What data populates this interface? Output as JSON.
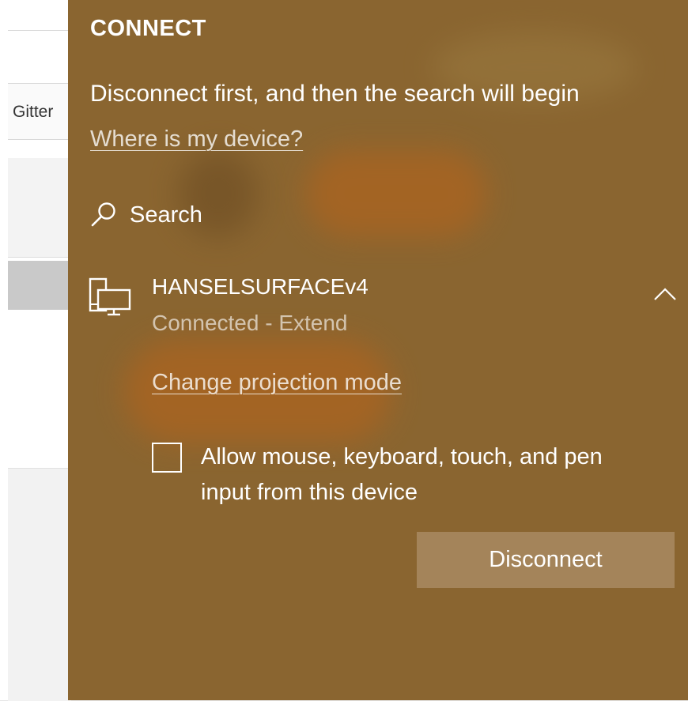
{
  "background_app": {
    "visible_tab_label": "Gitter"
  },
  "flyout": {
    "title": "CONNECT",
    "message": "Disconnect first, and then the search will begin",
    "where_link": "Where is my device?",
    "search": {
      "icon": "search-icon",
      "label": "Search"
    },
    "device": {
      "icon": "display-device-icon",
      "name": "HANSELSURFACEv4",
      "status": "Connected - Extend",
      "expand_icon": "chevron-up-icon",
      "change_projection_link": "Change projection mode",
      "allow_input": {
        "checked": false,
        "label": "Allow mouse, keyboard, touch, and pen input from this device"
      },
      "disconnect_label": "Disconnect"
    },
    "colors": {
      "panel_background": "#8a6530",
      "button_background": "#a4845a",
      "text": "#ffffff"
    }
  }
}
